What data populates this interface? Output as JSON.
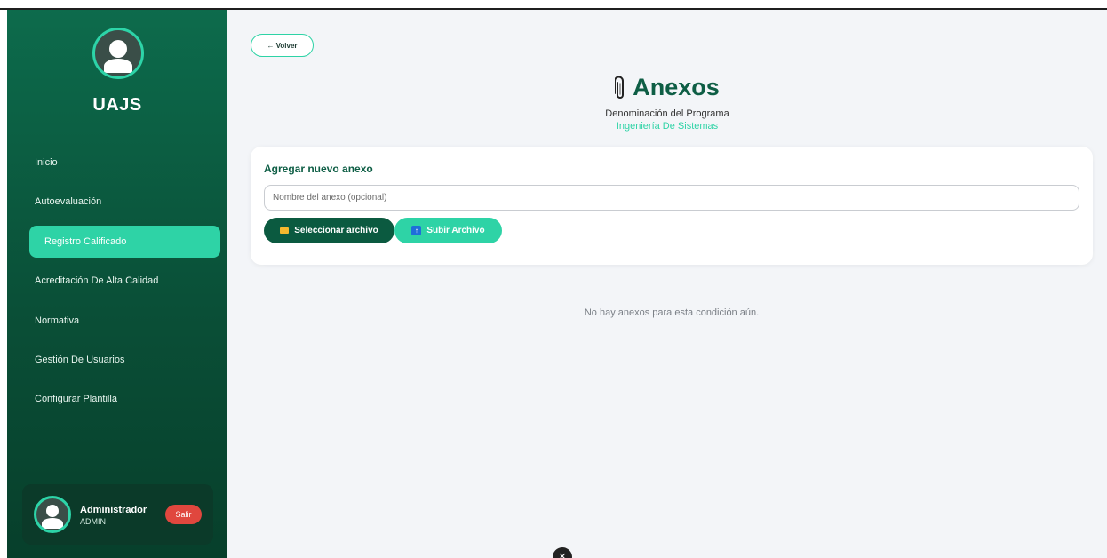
{
  "sidebar": {
    "brand": "UAJS",
    "items": [
      {
        "label": "Inicio"
      },
      {
        "label": "Autoevaluación"
      },
      {
        "label": "Registro Calificado"
      },
      {
        "label": "Acreditación De Alta Calidad"
      },
      {
        "label": "Normativa"
      },
      {
        "label": "Gestión De Usuarios"
      },
      {
        "label": "Configurar Plantilla"
      }
    ],
    "active_index": 2,
    "user": {
      "name": "Administrador",
      "role": "ADMIN",
      "logout_label": "Salir"
    }
  },
  "header": {
    "back_label": "← Volver",
    "title": "Anexos",
    "title_icon": "paperclip-icon",
    "subtitle": "Denominación del Programa",
    "program": "Ingeniería De Sistemas"
  },
  "form": {
    "title": "Agregar nuevo anexo",
    "name_placeholder": "Nombre del anexo (opcional)",
    "name_value": "",
    "select_label": "Seleccionar archivo",
    "select_icon": "folder-icon",
    "upload_label": "Subir Archivo",
    "upload_icon": "upload-icon"
  },
  "empty_message": "No hay anexos para esta condición aún.",
  "colors": {
    "sidebar_dark": "#0a4f37",
    "accent": "#2ed3a6",
    "primary": "#0e5e45",
    "danger": "#e0473e"
  }
}
